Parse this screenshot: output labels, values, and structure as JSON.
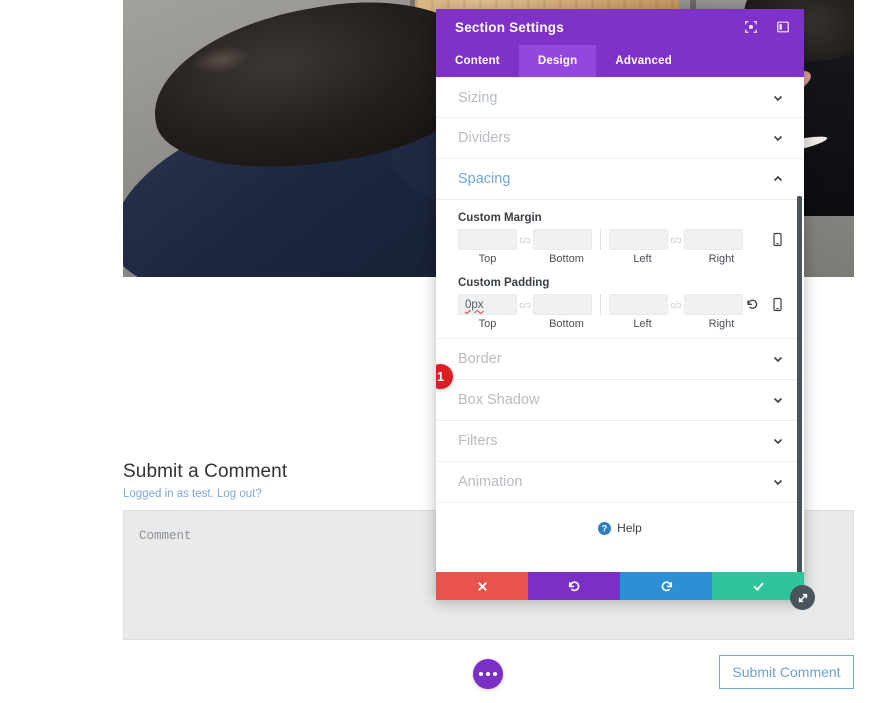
{
  "modal": {
    "title": "Section Settings",
    "titlebar_icons": [
      {
        "name": "focus-target-icon",
        "glyph": "target"
      },
      {
        "name": "panel-layout-icon",
        "glyph": "panel"
      }
    ],
    "tabs": [
      {
        "label": "Content",
        "active": false
      },
      {
        "label": "Design",
        "active": true
      },
      {
        "label": "Advanced",
        "active": false
      }
    ],
    "accordions": [
      {
        "label": "Sizing",
        "open": false
      },
      {
        "label": "Dividers",
        "open": false
      },
      {
        "label": "Spacing",
        "open": true
      },
      {
        "label": "Border",
        "open": false
      },
      {
        "label": "Box Shadow",
        "open": false
      },
      {
        "label": "Filters",
        "open": false
      },
      {
        "label": "Animation",
        "open": false
      }
    ],
    "spacing": {
      "margin_group_label": "Custom Margin",
      "padding_group_label": "Custom Padding",
      "side_labels": [
        "Top",
        "Bottom",
        "Left",
        "Right"
      ],
      "chain_symbol": "c/ɔ",
      "margin_values": [
        "",
        "",
        "",
        ""
      ],
      "padding_values": [
        "0px",
        "",
        "",
        ""
      ],
      "margin_row_icons": [
        "mobile-responsive-icon"
      ],
      "padding_row_icons": [
        "reset-icon",
        "mobile-responsive-icon"
      ]
    },
    "badge": {
      "number": "1"
    },
    "help": {
      "label": "Help",
      "icon": "help-circle-icon"
    },
    "footer_buttons": [
      {
        "name": "cancel-button",
        "icon": "close-icon",
        "color": "#e8534e"
      },
      {
        "name": "undo-button",
        "icon": "undo-icon",
        "color": "#7b2fc4"
      },
      {
        "name": "redo-button",
        "icon": "redo-icon",
        "color": "#2f8fd4"
      },
      {
        "name": "save-button",
        "icon": "check-icon",
        "color": "#2fc59a"
      }
    ],
    "resize_handle_icon": "resize-diagonal-icon"
  },
  "page": {
    "comment_heading": "Submit a Comment",
    "logged_in_text": "Logged in as test. Log out?",
    "comment_placeholder": "Comment",
    "submit_label": "Submit Comment",
    "fab_icon": "ellipsis-icon",
    "photo_alt": "overhead-photo-person-at-wooden-desk"
  },
  "colors": {
    "brand_purple": "#7f31c8",
    "tab_active": "#9447dc",
    "badge_red": "#d91f26",
    "open_section": "#6fa8d4",
    "save_teal": "#2fc59a",
    "redo_blue": "#2f8fd4",
    "cancel_red": "#e8534e"
  }
}
